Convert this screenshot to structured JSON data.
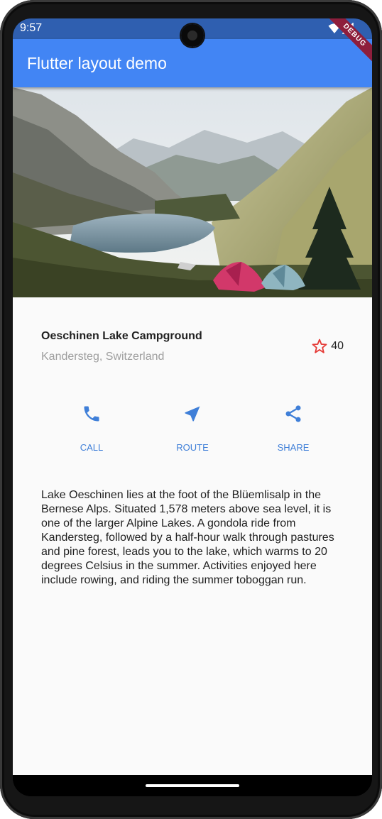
{
  "status_bar": {
    "time": "9:57"
  },
  "app_bar": {
    "title": "Flutter layout demo",
    "debug_label": "DEBUG"
  },
  "place": {
    "name": "Oeschinen Lake Campground",
    "location": "Kandersteg, Switzerland",
    "rating_count": "40"
  },
  "actions": [
    {
      "label": "CALL",
      "icon": "phone-icon"
    },
    {
      "label": "ROUTE",
      "icon": "navigation-icon"
    },
    {
      "label": "SHARE",
      "icon": "share-icon"
    }
  ],
  "description": "Lake Oeschinen lies at the foot of the Blüemlisalp in the Bernese Alps. Situated 1,578 meters above sea level, it is one of the larger Alpine Lakes. A gondola ride from Kandersteg, followed by a half-hour walk through pastures and pine forest, leads you to the lake, which warms to 20 degrees Celsius in the summer. Activities enjoyed here include rowing, and riding the summer toboggan run.",
  "colors": {
    "app_bar": "#4285f4",
    "accent": "#3f7fd8",
    "star": "#e53935",
    "debug": "#8e1e3c"
  }
}
